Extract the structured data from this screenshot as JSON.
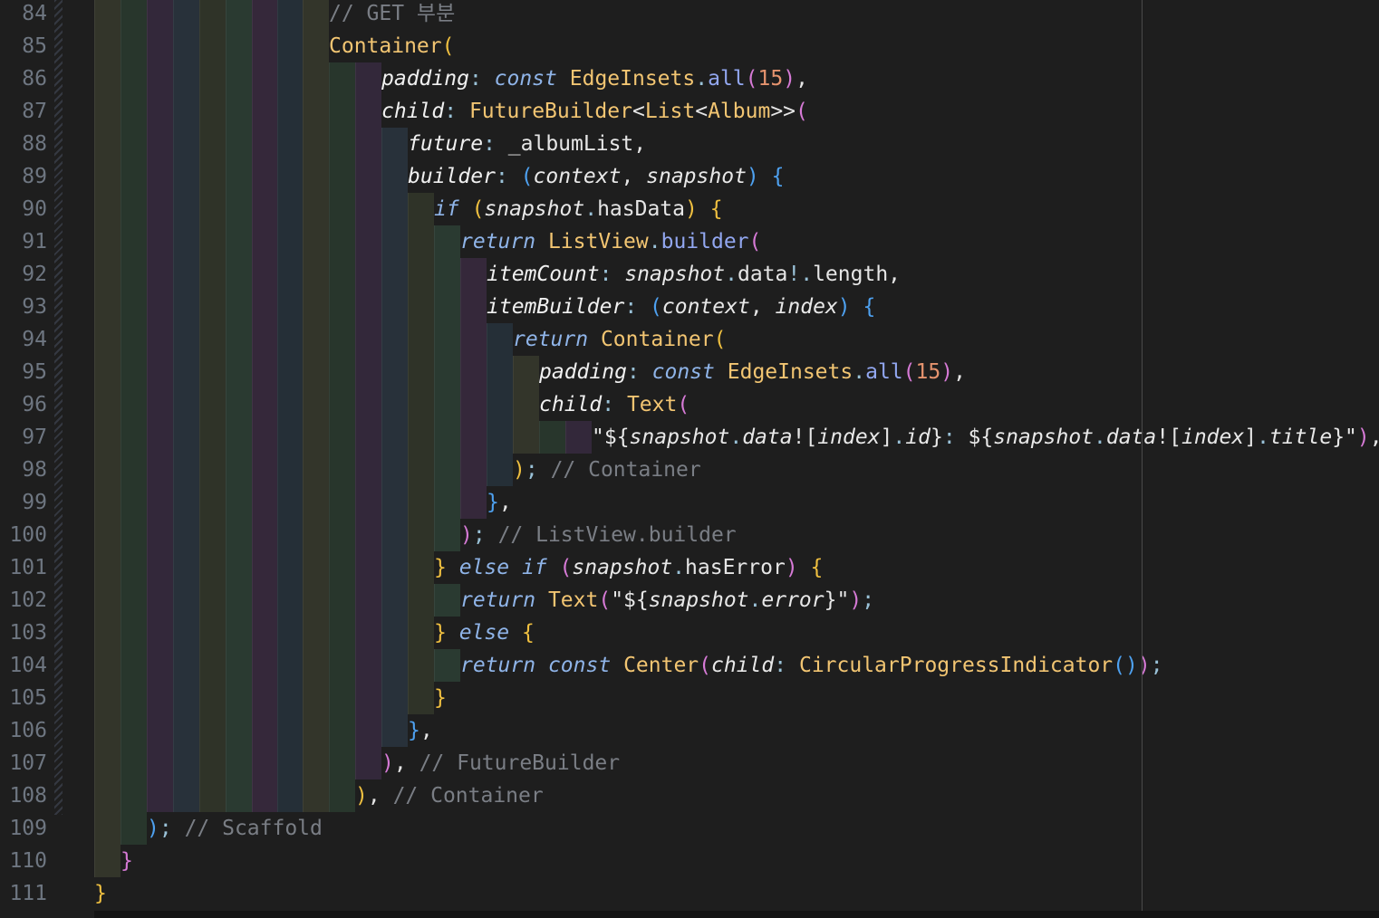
{
  "editor": {
    "language": "dart",
    "ruler_column": 110,
    "lines": [
      {
        "number": "84",
        "indent": 9,
        "tokens": [
          [
            "// GET 부분",
            "comment"
          ]
        ]
      },
      {
        "number": "85",
        "indent": 9,
        "tokens": [
          [
            "Container",
            "class"
          ],
          [
            "(",
            "paren2"
          ]
        ]
      },
      {
        "number": "86",
        "indent": 11,
        "tokens": [
          [
            "padding",
            "field"
          ],
          [
            ": ",
            "punct"
          ],
          [
            "const",
            "keyword"
          ],
          [
            " ",
            "plain"
          ],
          [
            "EdgeInsets",
            "class"
          ],
          [
            ".",
            "punct"
          ],
          [
            "all",
            "method"
          ],
          [
            "(",
            "paren1"
          ],
          [
            "15",
            "number"
          ],
          [
            ")",
            "paren1"
          ],
          [
            ",",
            "plain"
          ]
        ]
      },
      {
        "number": "87",
        "indent": 11,
        "tokens": [
          [
            "child",
            "field"
          ],
          [
            ": ",
            "punct"
          ],
          [
            "FutureBuilder",
            "class"
          ],
          [
            "<",
            "plain"
          ],
          [
            "List",
            "class"
          ],
          [
            "<",
            "plain"
          ],
          [
            "Album",
            "class"
          ],
          [
            ">>",
            "plain"
          ],
          [
            "(",
            "paren1"
          ]
        ]
      },
      {
        "number": "88",
        "indent": 12,
        "tokens": [
          [
            "future",
            "field"
          ],
          [
            ": ",
            "punct"
          ],
          [
            "_albumList",
            "plain"
          ],
          [
            ",",
            "plain"
          ]
        ]
      },
      {
        "number": "89",
        "indent": 12,
        "tokens": [
          [
            "builder",
            "field"
          ],
          [
            ": ",
            "punct"
          ],
          [
            "(",
            "paren3"
          ],
          [
            "context",
            "var"
          ],
          [
            ", ",
            "plain"
          ],
          [
            "snapshot",
            "var"
          ],
          [
            ")",
            "paren3"
          ],
          [
            " ",
            "plain"
          ],
          [
            "{",
            "paren3"
          ]
        ]
      },
      {
        "number": "90",
        "indent": 13,
        "tokens": [
          [
            "if",
            "keyword"
          ],
          [
            " ",
            "plain"
          ],
          [
            "(",
            "paren2"
          ],
          [
            "snapshot",
            "var"
          ],
          [
            ".",
            "punct"
          ],
          [
            "hasData",
            "plain"
          ],
          [
            ")",
            "paren2"
          ],
          [
            " ",
            "plain"
          ],
          [
            "{",
            "paren2"
          ]
        ]
      },
      {
        "number": "91",
        "indent": 14,
        "tokens": [
          [
            "return",
            "keyword"
          ],
          [
            " ",
            "plain"
          ],
          [
            "ListView",
            "class"
          ],
          [
            ".",
            "punct"
          ],
          [
            "builder",
            "method"
          ],
          [
            "(",
            "paren1"
          ]
        ]
      },
      {
        "number": "92",
        "indent": 15,
        "tokens": [
          [
            "itemCount",
            "field"
          ],
          [
            ": ",
            "punct"
          ],
          [
            "snapshot",
            "var"
          ],
          [
            ".",
            "punct"
          ],
          [
            "data",
            "plain"
          ],
          [
            "!",
            "punct"
          ],
          [
            ".",
            "punct"
          ],
          [
            "length",
            "plain"
          ],
          [
            ",",
            "plain"
          ]
        ]
      },
      {
        "number": "93",
        "indent": 15,
        "tokens": [
          [
            "itemBuilder",
            "field"
          ],
          [
            ": ",
            "punct"
          ],
          [
            "(",
            "paren3"
          ],
          [
            "context",
            "var"
          ],
          [
            ", ",
            "plain"
          ],
          [
            "index",
            "var"
          ],
          [
            ")",
            "paren3"
          ],
          [
            " ",
            "plain"
          ],
          [
            "{",
            "paren3"
          ]
        ]
      },
      {
        "number": "94",
        "indent": 16,
        "tokens": [
          [
            "return",
            "keyword"
          ],
          [
            " ",
            "plain"
          ],
          [
            "Container",
            "class"
          ],
          [
            "(",
            "paren2"
          ]
        ]
      },
      {
        "number": "95",
        "indent": 17,
        "tokens": [
          [
            "padding",
            "field"
          ],
          [
            ": ",
            "punct"
          ],
          [
            "const",
            "keyword"
          ],
          [
            " ",
            "plain"
          ],
          [
            "EdgeInsets",
            "class"
          ],
          [
            ".",
            "punct"
          ],
          [
            "all",
            "method"
          ],
          [
            "(",
            "paren1"
          ],
          [
            "15",
            "number"
          ],
          [
            ")",
            "paren1"
          ],
          [
            ",",
            "plain"
          ]
        ]
      },
      {
        "number": "96",
        "indent": 17,
        "tokens": [
          [
            "child",
            "field"
          ],
          [
            ": ",
            "punct"
          ],
          [
            "Text",
            "class"
          ],
          [
            "(",
            "paren1"
          ]
        ]
      },
      {
        "number": "97",
        "indent": 19,
        "tokens": [
          [
            "\"${",
            "string"
          ],
          [
            "snapshot",
            "var"
          ],
          [
            ".",
            "punct"
          ],
          [
            "data",
            "var"
          ],
          [
            "!",
            "plain"
          ],
          [
            "[",
            "plain"
          ],
          [
            "index",
            "var"
          ],
          [
            "]",
            "plain"
          ],
          [
            ".",
            "punct"
          ],
          [
            "id",
            "var"
          ],
          [
            "}",
            "string"
          ],
          [
            ":",
            "punct"
          ],
          [
            " ${",
            "string"
          ],
          [
            "snapshot",
            "var"
          ],
          [
            ".",
            "punct"
          ],
          [
            "data",
            "var"
          ],
          [
            "!",
            "plain"
          ],
          [
            "[",
            "plain"
          ],
          [
            "index",
            "var"
          ],
          [
            "]",
            "plain"
          ],
          [
            ".",
            "punct"
          ],
          [
            "title",
            "var"
          ],
          [
            "}\"",
            "string"
          ],
          [
            ")",
            "paren1"
          ],
          [
            ",",
            "plain"
          ]
        ]
      },
      {
        "number": "98",
        "indent": 16,
        "tokens": [
          [
            ")",
            "paren2"
          ],
          [
            "; ",
            "punct"
          ],
          [
            "// Container",
            "comment"
          ]
        ]
      },
      {
        "number": "99",
        "indent": 15,
        "tokens": [
          [
            "}",
            "paren3"
          ],
          [
            ",",
            "plain"
          ]
        ]
      },
      {
        "number": "100",
        "indent": 14,
        "tokens": [
          [
            ")",
            "paren1"
          ],
          [
            "; ",
            "punct"
          ],
          [
            "// ListView.builder",
            "comment"
          ]
        ]
      },
      {
        "number": "101",
        "indent": 13,
        "tokens": [
          [
            "}",
            "paren2"
          ],
          [
            " ",
            "plain"
          ],
          [
            "else",
            "keyword"
          ],
          [
            " ",
            "plain"
          ],
          [
            "if",
            "keyword"
          ],
          [
            " ",
            "plain"
          ],
          [
            "(",
            "paren1"
          ],
          [
            "snapshot",
            "var"
          ],
          [
            ".",
            "punct"
          ],
          [
            "hasError",
            "plain"
          ],
          [
            ")",
            "paren1"
          ],
          [
            " ",
            "plain"
          ],
          [
            "{",
            "paren2"
          ]
        ]
      },
      {
        "number": "102",
        "indent": 14,
        "tokens": [
          [
            "return",
            "keyword"
          ],
          [
            " ",
            "plain"
          ],
          [
            "Text",
            "class"
          ],
          [
            "(",
            "paren1"
          ],
          [
            "\"${",
            "string"
          ],
          [
            "snapshot",
            "var"
          ],
          [
            ".",
            "punct"
          ],
          [
            "error",
            "var"
          ],
          [
            "}\"",
            "string"
          ],
          [
            ")",
            "paren1"
          ],
          [
            ";",
            "punct"
          ]
        ]
      },
      {
        "number": "103",
        "indent": 13,
        "tokens": [
          [
            "}",
            "paren2"
          ],
          [
            " ",
            "plain"
          ],
          [
            "else",
            "keyword"
          ],
          [
            " ",
            "plain"
          ],
          [
            "{",
            "paren2"
          ]
        ]
      },
      {
        "number": "104",
        "indent": 14,
        "tokens": [
          [
            "return",
            "keyword"
          ],
          [
            " ",
            "plain"
          ],
          [
            "const",
            "keyword"
          ],
          [
            " ",
            "plain"
          ],
          [
            "Center",
            "class"
          ],
          [
            "(",
            "paren1"
          ],
          [
            "child",
            "var"
          ],
          [
            ": ",
            "punct"
          ],
          [
            "CircularProgressIndicator",
            "class"
          ],
          [
            "(",
            "paren3"
          ],
          [
            ")",
            "paren3"
          ],
          [
            ")",
            "paren1"
          ],
          [
            ";",
            "punct"
          ]
        ]
      },
      {
        "number": "105",
        "indent": 13,
        "tokens": [
          [
            "}",
            "paren2"
          ]
        ]
      },
      {
        "number": "106",
        "indent": 12,
        "tokens": [
          [
            "}",
            "paren3"
          ],
          [
            ",",
            "plain"
          ]
        ]
      },
      {
        "number": "107",
        "indent": 11,
        "tokens": [
          [
            ")",
            "paren1"
          ],
          [
            ", ",
            "plain"
          ],
          [
            "// FutureBuilder",
            "comment"
          ]
        ]
      },
      {
        "number": "108",
        "indent": 10,
        "tokens": [
          [
            ")",
            "paren2"
          ],
          [
            ", ",
            "plain"
          ],
          [
            "// Container",
            "comment"
          ]
        ]
      },
      {
        "number": "109",
        "indent": 2,
        "tokens": [
          [
            ")",
            "paren3"
          ],
          [
            "; ",
            "punct"
          ],
          [
            "// Scaffold",
            "comment"
          ]
        ]
      },
      {
        "number": "110",
        "indent": 1,
        "tokens": [
          [
            "}",
            "paren1"
          ]
        ]
      },
      {
        "number": "111",
        "indent": 0,
        "tokens": [
          [
            "}",
            "paren2"
          ]
        ]
      }
    ],
    "indent_guide_colors": [
      "#33352a",
      "#28362c",
      "#33283a",
      "#28313a",
      "#2f3328",
      "#2a3a31",
      "#35283a",
      "#252f37"
    ]
  }
}
